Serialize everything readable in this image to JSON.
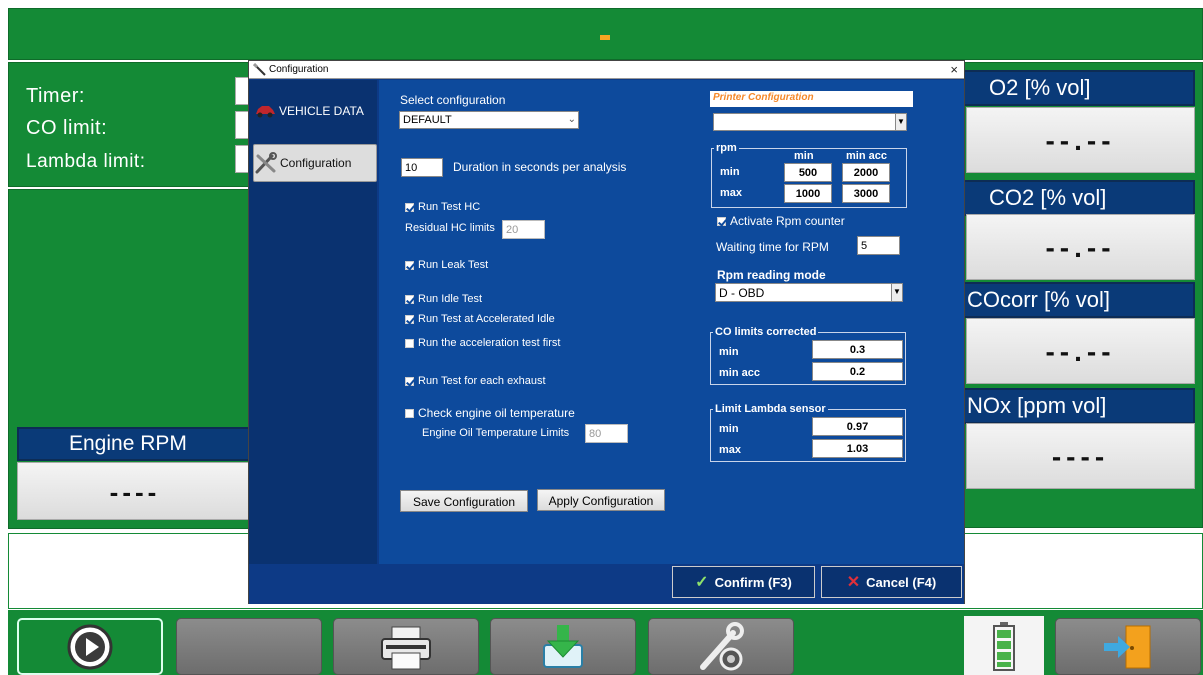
{
  "top_bar": {
    "indicator": "-"
  },
  "left_info": {
    "timer_label": "Timer:",
    "co_limit_label": "CO limit:",
    "lambda_limit_label": "Lambda limit:"
  },
  "engine_rpm": {
    "label": "Engine RPM",
    "value": "----"
  },
  "gases": [
    {
      "label": "O2 [% vol]",
      "value": "--.--"
    },
    {
      "label": "CO2 [% vol]",
      "value": "--.--"
    },
    {
      "label": "COcorr [% vol]",
      "value": "--.--"
    },
    {
      "label": "NOx [ppm vol]",
      "value": "----"
    }
  ],
  "dialog": {
    "title": "Configuration",
    "close": "×",
    "nav": [
      {
        "label": "VEHICLE DATA",
        "icon": "car-icon"
      },
      {
        "label": "Configuration",
        "icon": "tools-icon"
      }
    ],
    "select_config_label": "Select configuration",
    "select_config_value": "DEFAULT",
    "duration_value": "10",
    "duration_label": "Duration in seconds per analysis",
    "run_test_hc": "Run Test HC",
    "residual_hc_label": "Residual HC limits",
    "residual_hc_value": "20",
    "run_leak_test": "Run Leak Test",
    "run_idle_test": "Run Idle Test",
    "run_accel_idle": "Run Test at Accelerated Idle",
    "run_accel_first": "Run the acceleration test first",
    "run_each_exhaust": "Run Test for each exhaust",
    "check_oil_temp": "Check engine oil temperature",
    "oil_temp_limits_label": "Engine Oil Temperature Limits",
    "oil_temp_limits_value": "80",
    "save_button": "Save Configuration",
    "apply_button": "Apply Configuration",
    "printer_label": "Printer Configuration",
    "printer_value": "",
    "rpm_group": {
      "title": "rpm",
      "col_min": "min",
      "col_min_acc": "min acc",
      "row_min": "min",
      "row_max": "max",
      "min_min": "500",
      "min_min_acc": "2000",
      "max_min": "1000",
      "max_min_acc": "3000"
    },
    "activate_rpm_counter": "Activate Rpm counter",
    "waiting_time_label": "Waiting time for RPM",
    "waiting_time_value": "5",
    "rpm_reading_mode_label": "Rpm reading mode",
    "rpm_reading_mode_value": "D - OBD",
    "co_limits": {
      "title": "CO limits corrected",
      "min_label": "min",
      "min_value": "0.3",
      "min_acc_label": "min acc",
      "min_acc_value": "0.2"
    },
    "lambda_limits": {
      "title": "Limit Lambda sensor",
      "min_label": "min",
      "min_value": "0.97",
      "max_label": "max",
      "max_value": "1.03"
    },
    "confirm_button": "Confirm (F3)",
    "cancel_button": "Cancel (F4)"
  },
  "colors": {
    "app_green": "#148a36",
    "header_navy": "#0a3a78",
    "dialog_blue": "#0d4a9c",
    "printer_label_orange": "#f5892a"
  }
}
